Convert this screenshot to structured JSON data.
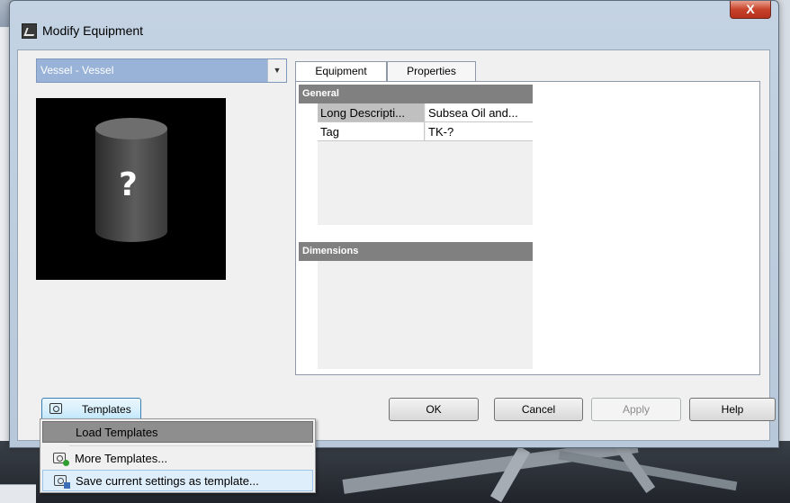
{
  "dialog": {
    "title": "Modify Equipment",
    "close_glyph": "X"
  },
  "equipment_selector": {
    "selected": "Vessel - Vessel"
  },
  "preview": {
    "placeholder_glyph": "?"
  },
  "tabs": [
    {
      "label": "Equipment",
      "active": true
    },
    {
      "label": "Properties",
      "active": false
    }
  ],
  "property_grid": {
    "categories": [
      {
        "name": "General",
        "rows": [
          {
            "name": "Long Descripti...",
            "value": "Subsea Oil and..."
          },
          {
            "name": "Tag",
            "value": "TK-?"
          }
        ]
      },
      {
        "name": "Dimensions",
        "rows": []
      }
    ]
  },
  "buttons": {
    "templates": "Templates",
    "ok": "OK",
    "cancel": "Cancel",
    "apply": "Apply",
    "help": "Help"
  },
  "templates_menu": {
    "items": [
      {
        "label": "Load Templates"
      },
      {
        "label": "More Templates..."
      },
      {
        "label": "Save current settings as template..."
      }
    ]
  },
  "icons": {
    "app": "app-logo-icon",
    "templates": "camera-icon",
    "more_templates": "camera-plus-icon",
    "save_template": "camera-save-icon"
  },
  "colors": {
    "selection_blue": "#99b3d8",
    "category_gray": "#808080",
    "close_red": "#c8432c"
  }
}
